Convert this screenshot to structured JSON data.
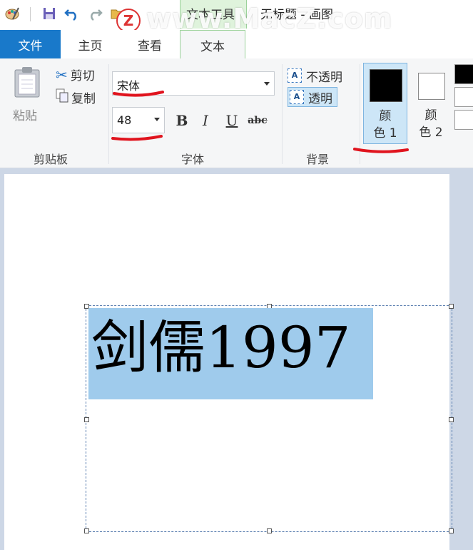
{
  "window": {
    "title": "无标题 - 画图",
    "context_tab": "文本工具",
    "watermark": "www.MacZ.com",
    "watermark_logo": "Z"
  },
  "quick_access": {
    "icons": [
      "paint-app-icon",
      "save-icon",
      "undo-icon",
      "redo-icon",
      "folder-icon"
    ]
  },
  "tabs": [
    {
      "label": "文件"
    },
    {
      "label": "主页"
    },
    {
      "label": "查看"
    },
    {
      "label": "文本"
    }
  ],
  "clipboard": {
    "paste_label": "粘贴",
    "cut_label": "剪切",
    "copy_label": "复制",
    "group_label": "剪贴板"
  },
  "font": {
    "name": "宋体",
    "size": "48",
    "bold_label": "B",
    "italic_label": "I",
    "underline_label": "U",
    "strike_label": "abc",
    "group_label": "字体"
  },
  "background": {
    "opaque_label": "不透明",
    "transparent_label": "透明",
    "opaque_icon_glyph": "A",
    "transparent_icon_glyph": "A",
    "group_label": "背景",
    "selected": "透明"
  },
  "colors": {
    "color1_label_line1": "颜",
    "color1_label_line2": "色 1",
    "color2_label_line1": "颜",
    "color2_label_line2": "色 2",
    "color1_value": "#000000",
    "color2_value": "#ffffff"
  },
  "canvas": {
    "text": "剑儒1997",
    "selection_color": "#9fcbec"
  },
  "accent": {
    "file_tab": "#1979ca",
    "context_tab": "#dff3dc",
    "annotation_red": "#e0141e"
  }
}
